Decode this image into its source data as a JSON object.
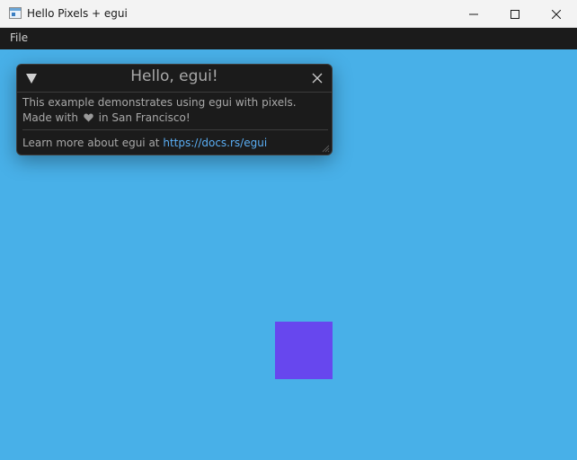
{
  "window": {
    "title": "Hello Pixels + egui",
    "controls": {
      "minimize": "minimize-icon",
      "maximize": "maximize-icon",
      "close": "close-icon"
    }
  },
  "menubar": {
    "items": [
      {
        "label": "File"
      }
    ]
  },
  "egui_window": {
    "title": "Hello, egui!",
    "line1": "This example demonstrates using egui with pixels.",
    "line2_prefix": "Made with",
    "line2_suffix": "in San Francisco!",
    "learn_prefix": "Learn more about egui at",
    "link_text": "https://docs.rs/egui",
    "icons": {
      "collapse": "triangle-down-icon",
      "close": "close-icon",
      "heart": "heart-icon",
      "resize": "resize-grip-icon"
    }
  },
  "colors": {
    "background": "#48b0e8",
    "square": "#6747ee",
    "window_bg": "#1b1b1b",
    "text": "#a8a8a8",
    "link": "#5aaef4",
    "menubar": "#1b1b1b"
  }
}
